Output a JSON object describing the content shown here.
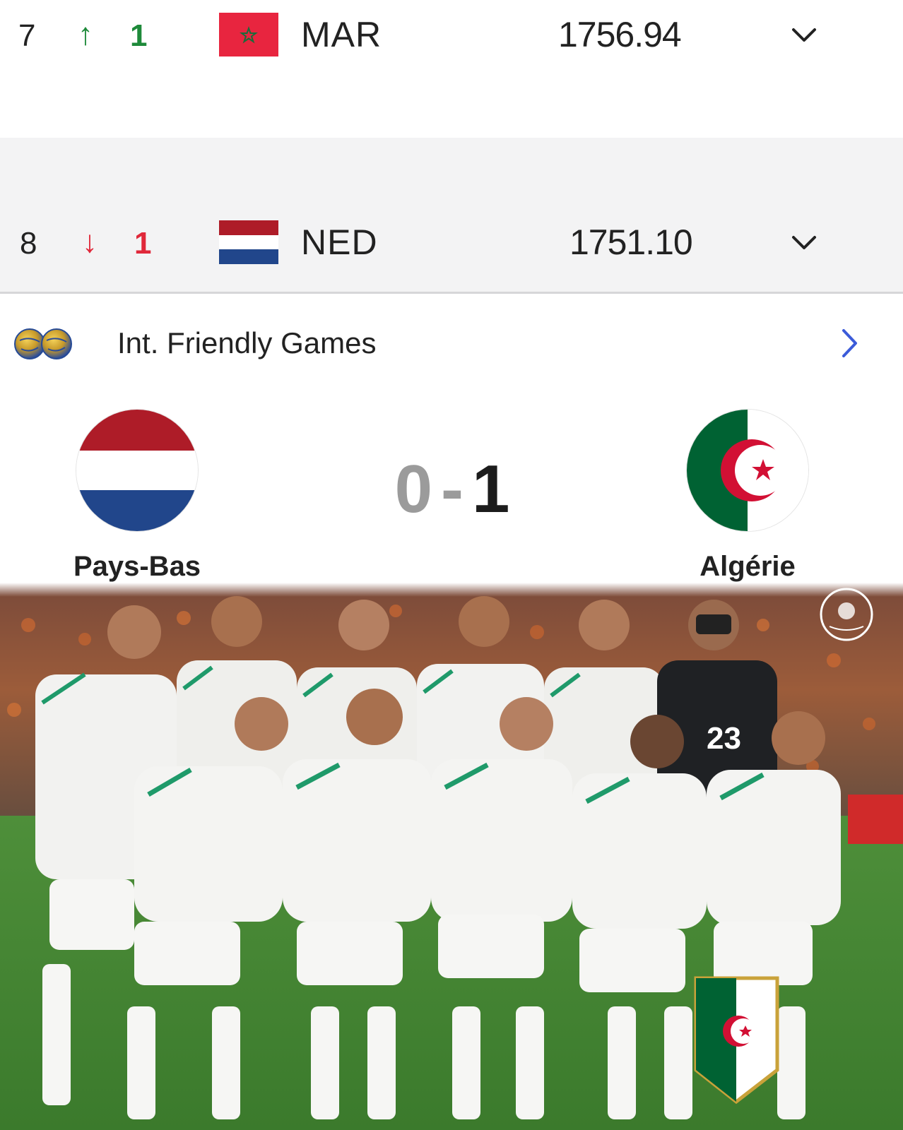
{
  "rankings": [
    {
      "rank": "7",
      "trend": "↑",
      "trend_value": "1",
      "trend_color": "#1e8a3a",
      "code": "MAR",
      "points": "1756.94"
    },
    {
      "rank": "8",
      "trend": "↓",
      "trend_value": "1",
      "trend_color": "#e0283a",
      "code": "NED",
      "points": "1751.10"
    }
  ],
  "competition": {
    "title": "Int. Friendly Games",
    "icon": "globe-balls-icon",
    "arrow_color": "#3b5bd9"
  },
  "match": {
    "home_team": "Pays-Bas",
    "away_team": "Algérie",
    "home_score": "0",
    "separator": "-",
    "away_score": "1"
  },
  "photo": {
    "subject": "team-photo",
    "jersey_number": "23"
  },
  "colors": {
    "ned_red": "#ae1c28",
    "ned_blue": "#21468b",
    "alg_green": "#006233",
    "alg_red": "#d21034",
    "mar_red": "#e8253f"
  }
}
